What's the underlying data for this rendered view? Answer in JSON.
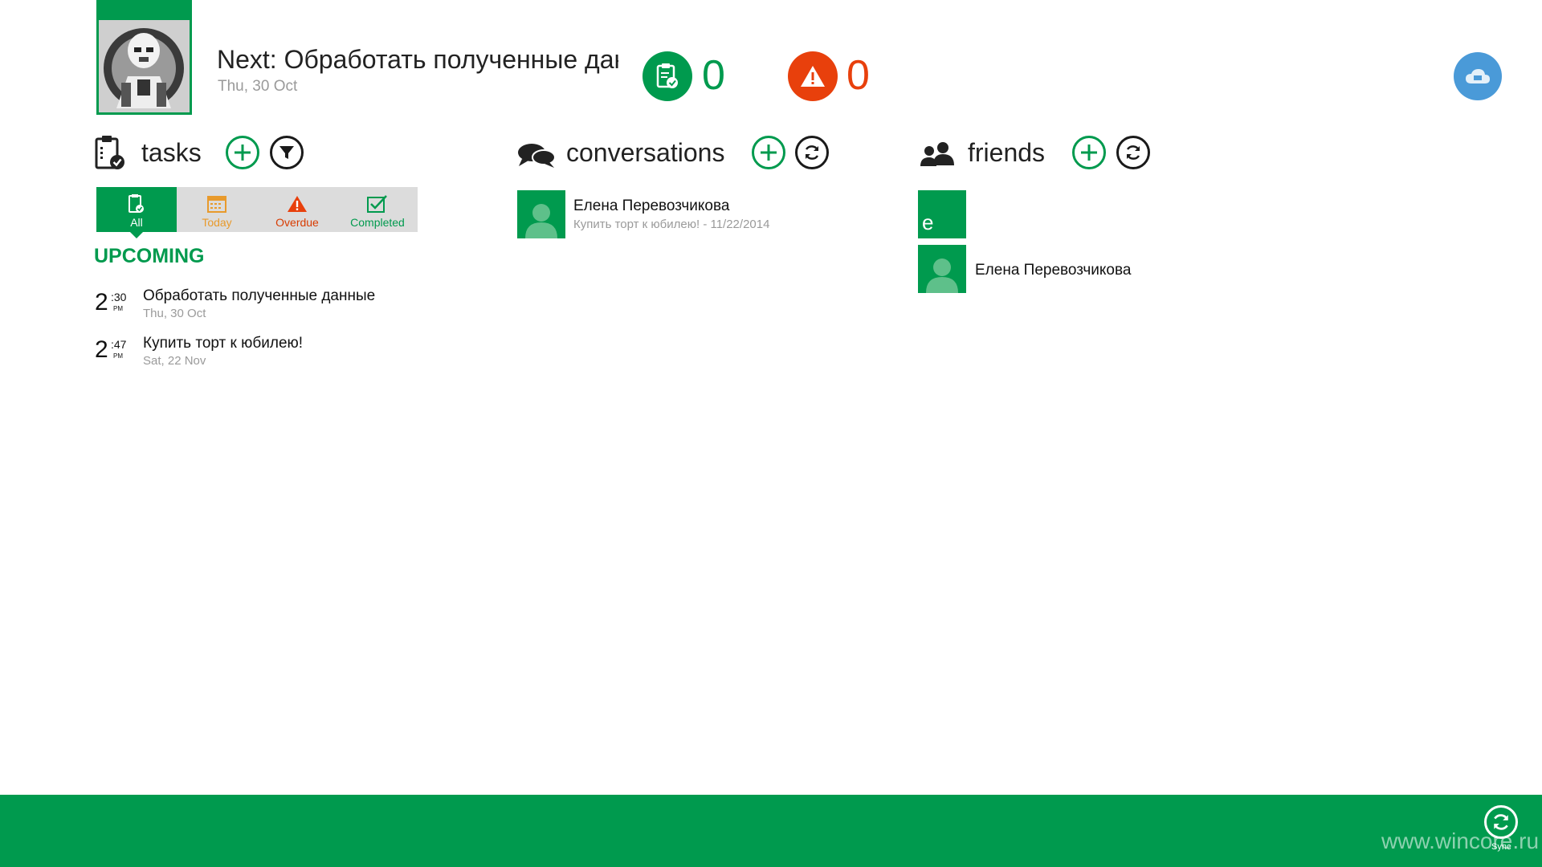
{
  "header": {
    "next_title": "Next: Обработать полученные данн",
    "next_date": "Thu, 30 Oct",
    "tasks_count": "0",
    "overdue_count": "0"
  },
  "colors": {
    "green": "#009a4e",
    "orange_red": "#e8400c",
    "today_orange": "#e89a2c",
    "cloud_blue": "#4a9ad8"
  },
  "sections": {
    "tasks": {
      "title": "tasks"
    },
    "conversations": {
      "title": "conversations"
    },
    "friends": {
      "title": "friends"
    }
  },
  "filter_tabs": [
    {
      "label": "All",
      "icon": "clipboard-check-icon",
      "active": true
    },
    {
      "label": "Today",
      "icon": "calendar-icon",
      "active": false
    },
    {
      "label": "Overdue",
      "icon": "warning-icon",
      "active": false
    },
    {
      "label": "Completed",
      "icon": "check-box-icon",
      "active": false
    }
  ],
  "upcoming": {
    "heading": "UPCOMING",
    "tasks": [
      {
        "hour": "2",
        "minute": ":30",
        "ampm": "PM",
        "name": "Обработать полученные данные",
        "date": "Thu, 30 Oct"
      },
      {
        "hour": "2",
        "minute": ":47",
        "ampm": "PM",
        "name": "Купить торт к юбилею!",
        "date": "Sat, 22 Nov"
      }
    ]
  },
  "conversations": [
    {
      "name": "Елена Перевозчикова",
      "preview": "Купить торт к юбилею! - 11/22/2014"
    }
  ],
  "friends": {
    "group_letter": "e",
    "items": [
      {
        "name": "Елена Перевозчикова"
      }
    ]
  },
  "appbar": {
    "sync_label": "Sync",
    "watermark": "www.wincore.ru"
  }
}
